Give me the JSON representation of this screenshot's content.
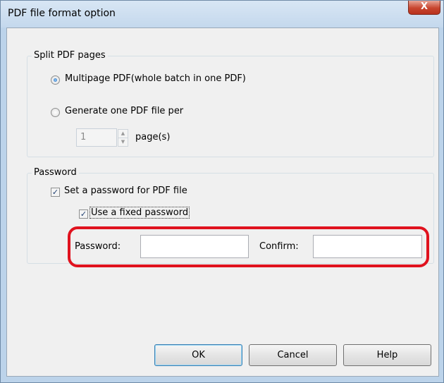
{
  "window": {
    "title": "PDF file format option",
    "close_label": "X"
  },
  "split_group": {
    "legend": "Split PDF pages",
    "option_multipage": {
      "label": "Multipage PDF(whole batch in one PDF)",
      "selected": true
    },
    "option_per_page": {
      "label": "Generate one PDF file per",
      "selected": false
    },
    "pages_value": "1",
    "pages_unit": "page(s)"
  },
  "password_group": {
    "legend": "Password",
    "set_password": {
      "label": "Set a password for PDF file",
      "checked": true
    },
    "fixed_password": {
      "label": "Use a fixed password",
      "checked": true
    },
    "password_label": "Password:",
    "password_value": "",
    "confirm_label": "Confirm:",
    "confirm_value": ""
  },
  "buttons": {
    "ok": "OK",
    "cancel": "Cancel",
    "help": "Help"
  },
  "colors": {
    "highlight": "#e0121e",
    "title_bar": "#c4d8ed",
    "close_button": "#c8452e"
  }
}
